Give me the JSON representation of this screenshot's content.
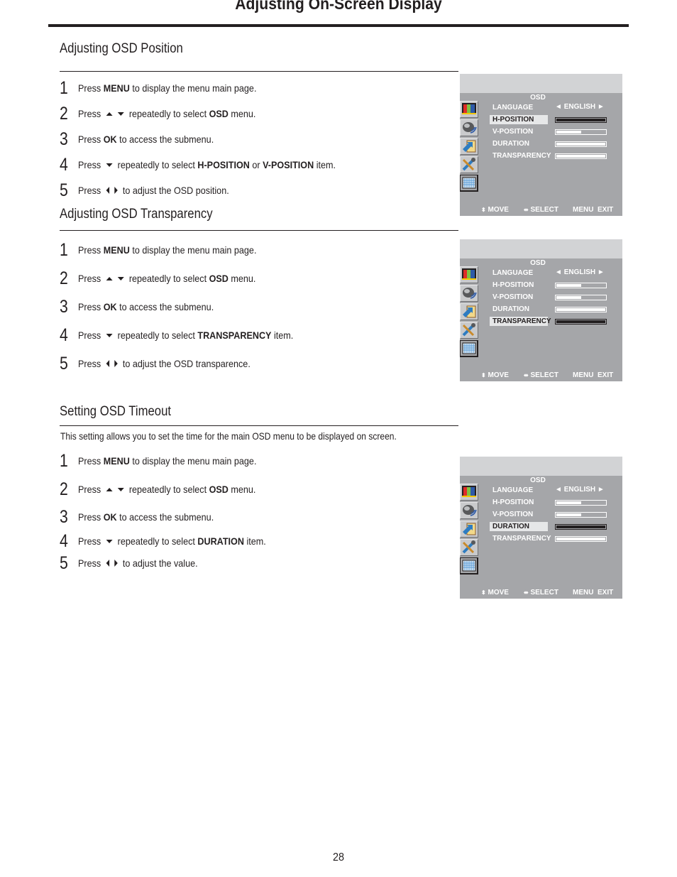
{
  "page": {
    "title": "Adjusting On-Screen Display",
    "page_number": "28"
  },
  "sections": [
    {
      "heading": "Adjusting OSD Position",
      "steps": [
        {
          "num": "1",
          "pre": "Press ",
          "bold": "MENU",
          "post": " to display the menu main page."
        },
        {
          "num": "2",
          "pre": "Press",
          "keys": [
            "up",
            "down"
          ],
          "mid": "repeatedly to select ",
          "bold": "OSD",
          "post": " menu."
        },
        {
          "num": "3",
          "pre": "Press ",
          "bold": "OK",
          "post": " to access the submenu."
        },
        {
          "num": "4",
          "pre": "Press",
          "keys": [
            "down"
          ],
          "mid": "repeatedly to select ",
          "bold": "H-POSITION",
          "mid2": " or ",
          "bold2": "V-POSITION",
          "post": " item."
        },
        {
          "num": "5",
          "pre": "Press",
          "keys": [
            "left",
            "right"
          ],
          "post": "to adjust the OSD position."
        }
      ],
      "osd": {
        "title": "OSD",
        "selected": "H-POSITION",
        "items": [
          {
            "label": "LANGUAGE",
            "value": "ENGLISH"
          },
          {
            "label": "H-POSITION",
            "level": 0.5
          },
          {
            "label": "V-POSITION",
            "level": 0.5
          },
          {
            "label": "DURATION",
            "level": 1.0
          },
          {
            "label": "TRANSPARENCY",
            "level": 1.0
          }
        ],
        "footer": {
          "move": "MOVE",
          "select": "SELECT",
          "menu": "MENU",
          "exit": "EXIT"
        }
      }
    },
    {
      "heading": "Adjusting OSD Transparency",
      "steps": [
        {
          "num": "1",
          "pre": "Press ",
          "bold": "MENU",
          "post": " to display the menu main page."
        },
        {
          "num": "2",
          "pre": "Press",
          "keys": [
            "up",
            "down"
          ],
          "mid": "repeatedly to select ",
          "bold": "OSD",
          "post": " menu."
        },
        {
          "num": "3",
          "pre": "Press ",
          "bold": "OK",
          "post": " to access the submenu."
        },
        {
          "num": "4",
          "pre": "Press",
          "keys": [
            "down"
          ],
          "mid": "repeatedly to select ",
          "bold": "TRANSPARENCY",
          "post": " item."
        },
        {
          "num": "5",
          "pre": "Press",
          "keys": [
            "left",
            "right"
          ],
          "post": "to adjust the OSD transparence."
        }
      ],
      "osd": {
        "title": "OSD",
        "selected": "TRANSPARENCY",
        "items": [
          {
            "label": "LANGUAGE",
            "value": "ENGLISH"
          },
          {
            "label": "H-POSITION",
            "level": 0.5
          },
          {
            "label": "V-POSITION",
            "level": 0.5
          },
          {
            "label": "DURATION",
            "level": 1.0
          },
          {
            "label": "TRANSPARENCY",
            "level": 1.0
          }
        ],
        "footer": {
          "move": "MOVE",
          "select": "SELECT",
          "menu": "MENU",
          "exit": "EXIT"
        }
      }
    },
    {
      "heading": "Setting OSD  Timeout",
      "intro": "This setting allows you to set the time for the main OSD menu to be displayed on screen.",
      "steps": [
        {
          "num": "1",
          "pre": "Press ",
          "bold": "MENU",
          "post": " to display the menu main page."
        },
        {
          "num": "2",
          "pre": "Press",
          "keys": [
            "up",
            "down"
          ],
          "mid": "repeatedly to select ",
          "bold": "OSD",
          "post": " menu."
        },
        {
          "num": "3",
          "pre": "Press ",
          "bold": "OK",
          "post": " to access the submenu."
        },
        {
          "num": "4",
          "pre": "Press",
          "keys": [
            "down"
          ],
          "mid": "repeatedly to select ",
          "bold": "DURATION",
          "post": " item."
        },
        {
          "num": "5",
          "pre": "Press",
          "keys": [
            "left",
            "right"
          ],
          "post": "to adjust the value."
        }
      ],
      "osd": {
        "title": "OSD",
        "selected": "DURATION",
        "items": [
          {
            "label": "LANGUAGE",
            "value": "ENGLISH"
          },
          {
            "label": "H-POSITION",
            "level": 0.5
          },
          {
            "label": "V-POSITION",
            "level": 0.5
          },
          {
            "label": "DURATION",
            "level": 1.0
          },
          {
            "label": "TRANSPARENCY",
            "level": 1.0
          }
        ],
        "footer": {
          "move": "MOVE",
          "select": "SELECT",
          "menu": "MENU",
          "exit": "EXIT"
        }
      }
    }
  ],
  "osd_icons": [
    "picture-icon",
    "audio-speaker-icon",
    "setup-arrow-icon",
    "tools-icon",
    "osd-grid-icon"
  ],
  "colors": {
    "panel_body": "#a5a6a9",
    "panel_top": "#d2d3d5",
    "text_dark": "#231f20"
  }
}
